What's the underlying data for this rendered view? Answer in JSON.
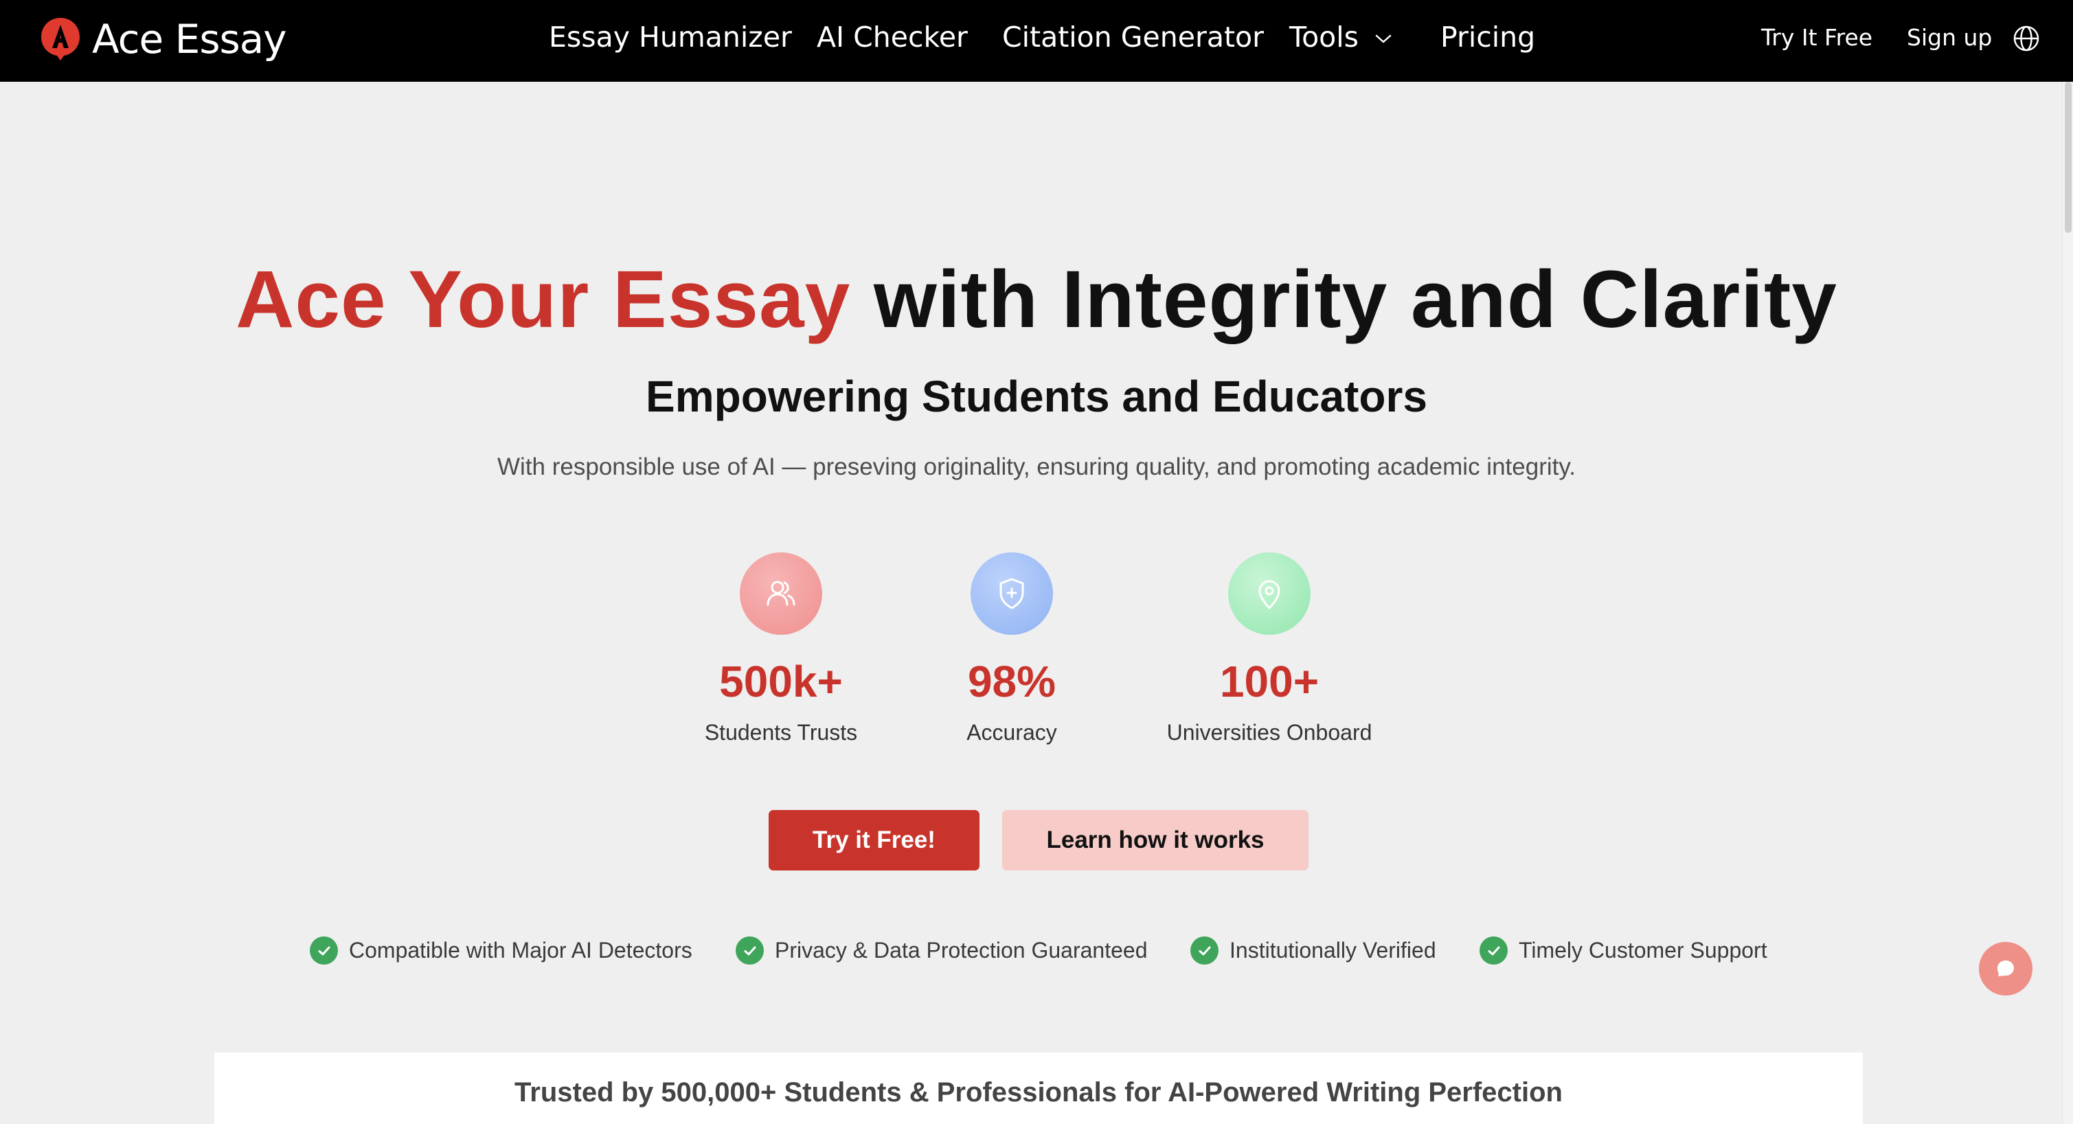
{
  "brand": {
    "name": "Ace Essay",
    "accent": "#c8342c"
  },
  "nav": {
    "links": [
      "Essay Humanizer",
      "AI Checker",
      "Citation Generator",
      "Tools",
      "Pricing"
    ],
    "try_free": "Try It Free",
    "sign_up": "Sign up",
    "tools_icon": "chevron-down-icon",
    "language_icon": "globe-icon"
  },
  "hero": {
    "title_highlight": "Ace Your Essay",
    "title_rest": "with Integrity and Clarity",
    "subtitle": "Empowering Students and Educators",
    "description": "With responsible use of AI — preseving originality, ensuring quality, and promoting academic integrity."
  },
  "stats": [
    {
      "icon": "users-icon",
      "value": "500k+",
      "label": "Students Trusts"
    },
    {
      "icon": "shield-icon",
      "value": "98%",
      "label": "Accuracy"
    },
    {
      "icon": "location-pin-icon",
      "value": "100+",
      "label": "Universities Onboard"
    }
  ],
  "cta": {
    "primary": "Try it Free!",
    "secondary": "Learn how it works"
  },
  "features": [
    "Compatible with Major AI Detectors",
    "Privacy & Data Protection Guaranteed",
    "Institutionally Verified",
    "Timely Customer Support"
  ],
  "trust": {
    "text": "Trusted by 500,000+ Students & Professionals for AI-Powered Writing Perfection"
  },
  "chat": {
    "icon": "chat-bubble-icon"
  }
}
